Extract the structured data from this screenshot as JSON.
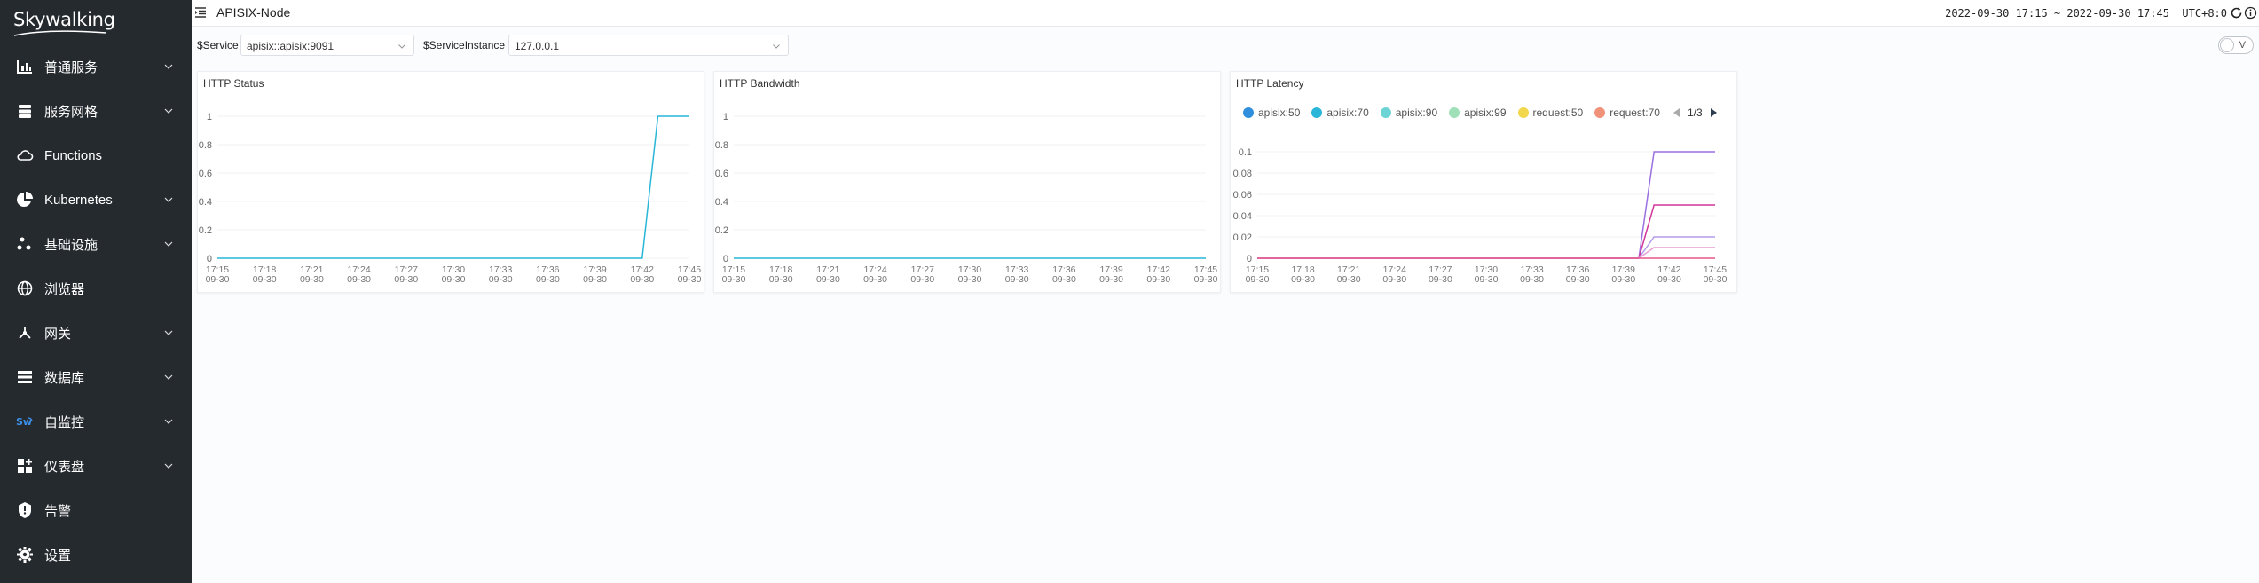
{
  "app": {
    "logo_text": "Skywalking"
  },
  "sidebar": {
    "items": [
      {
        "label": "普通服务",
        "icon": "chart-bar-icon",
        "has_arrow": true
      },
      {
        "label": "服务网格",
        "icon": "database-stack-icon",
        "has_arrow": true
      },
      {
        "label": "Functions",
        "icon": "cloud-icon",
        "has_arrow": false
      },
      {
        "label": "Kubernetes",
        "icon": "pie-chart-icon",
        "has_arrow": true
      },
      {
        "label": "基础设施",
        "icon": "nodes-icon",
        "has_arrow": true
      },
      {
        "label": "浏览器",
        "icon": "globe-icon",
        "has_arrow": false
      },
      {
        "label": "网关",
        "icon": "gateway-icon",
        "has_arrow": true
      },
      {
        "label": "数据库",
        "icon": "list-icon",
        "has_arrow": true
      },
      {
        "label": "自监控",
        "icon": "sw-icon",
        "has_arrow": true
      },
      {
        "label": "仪表盘",
        "icon": "dashboard-grid-icon",
        "has_arrow": true
      },
      {
        "label": "告警",
        "icon": "alert-shield-icon",
        "has_arrow": false
      },
      {
        "label": "设置",
        "icon": "gear-icon",
        "has_arrow": false
      }
    ]
  },
  "header": {
    "title": "APISIX-Node",
    "time_range": "2022-09-30 17:15 ~ 2022-09-30 17:45",
    "timezone": "UTC+8:0"
  },
  "filters": {
    "service_label": "$Service",
    "service_value": "apisix::apisix:9091",
    "instance_label": "$ServiceInstance",
    "instance_value": "127.0.0.1",
    "toggle_label": "V"
  },
  "chart_data": [
    {
      "type": "line",
      "title": "HTTP Status",
      "x": [
        "17:15\n09-30",
        "17:18\n09-30",
        "17:21\n09-30",
        "17:24\n09-30",
        "17:27\n09-30",
        "17:30\n09-30",
        "17:33\n09-30",
        "17:36\n09-30",
        "17:39\n09-30",
        "17:42\n09-30",
        "17:45\n09-30"
      ],
      "yticks": [
        "0",
        "0.2",
        "0.4",
        "0.6",
        "0.8",
        "1"
      ],
      "ylim": [
        0,
        1
      ],
      "series": [
        {
          "color": "#29b6d8",
          "values": [
            0,
            0,
            0,
            0,
            0,
            0,
            0,
            0,
            0,
            0,
            0,
            0,
            0,
            0,
            0,
            0,
            0,
            0,
            0,
            0,
            0,
            0,
            0,
            0,
            0,
            0,
            0,
            0,
            1,
            1,
            1
          ]
        }
      ]
    },
    {
      "type": "line",
      "title": "HTTP Bandwidth",
      "x": [
        "17:15\n09-30",
        "17:18\n09-30",
        "17:21\n09-30",
        "17:24\n09-30",
        "17:27\n09-30",
        "17:30\n09-30",
        "17:33\n09-30",
        "17:36\n09-30",
        "17:39\n09-30",
        "17:42\n09-30",
        "17:45\n09-30"
      ],
      "yticks": [
        "0",
        "0.2",
        "0.4",
        "0.6",
        "0.8",
        "1"
      ],
      "ylim": [
        0,
        1
      ],
      "series": [
        {
          "color": "#29b6d8",
          "values": [
            0,
            0,
            0,
            0,
            0,
            0,
            0,
            0,
            0,
            0,
            0,
            0,
            0,
            0,
            0,
            0,
            0,
            0,
            0,
            0,
            0,
            0,
            0,
            0,
            0,
            0,
            0,
            0,
            0,
            0,
            0
          ]
        }
      ]
    },
    {
      "type": "line",
      "title": "HTTP Latency",
      "x": [
        "17:15\n09-30",
        "17:18\n09-30",
        "17:21\n09-30",
        "17:24\n09-30",
        "17:27\n09-30",
        "17:30\n09-30",
        "17:33\n09-30",
        "17:36\n09-30",
        "17:39\n09-30",
        "17:42\n09-30",
        "17:45\n09-30"
      ],
      "yticks": [
        "0",
        "0.02",
        "0.04",
        "0.06",
        "0.08",
        "0.1"
      ],
      "ylim": [
        0,
        0.1
      ],
      "legend": {
        "items": [
          {
            "name": "apisix:50",
            "color": "#2f8fdc"
          },
          {
            "name": "apisix:70",
            "color": "#29b6d8"
          },
          {
            "name": "apisix:90",
            "color": "#6cd4d4"
          },
          {
            "name": "apisix:99",
            "color": "#9fe0b8"
          },
          {
            "name": "request:50",
            "color": "#f2d64b"
          },
          {
            "name": "request:70",
            "color": "#f0917a"
          }
        ],
        "page": "1/3"
      },
      "series": [
        {
          "color": "#9a6fe0",
          "values": [
            0,
            0,
            0,
            0,
            0,
            0,
            0,
            0,
            0,
            0,
            0,
            0,
            0,
            0,
            0,
            0,
            0,
            0,
            0,
            0,
            0,
            0,
            0,
            0,
            0,
            0,
            0.1,
            0.1,
            0.1,
            0.1,
            0.1
          ]
        },
        {
          "color": "#d1369a",
          "values": [
            0,
            0,
            0,
            0,
            0,
            0,
            0,
            0,
            0,
            0,
            0,
            0,
            0,
            0,
            0,
            0,
            0,
            0,
            0,
            0,
            0,
            0,
            0,
            0,
            0,
            0,
            0.05,
            0.05,
            0.05,
            0.05,
            0.05
          ]
        },
        {
          "color": "#b39be8",
          "values": [
            0,
            0,
            0,
            0,
            0,
            0,
            0,
            0,
            0,
            0,
            0,
            0,
            0,
            0,
            0,
            0,
            0,
            0,
            0,
            0,
            0,
            0,
            0,
            0,
            0,
            0,
            0.02,
            0.02,
            0.02,
            0.02,
            0.02
          ]
        },
        {
          "color": "#e6a0d2",
          "values": [
            0,
            0,
            0,
            0,
            0,
            0,
            0,
            0,
            0,
            0,
            0,
            0,
            0,
            0,
            0,
            0,
            0,
            0,
            0,
            0,
            0,
            0,
            0,
            0,
            0,
            0,
            0.01,
            0.01,
            0.01,
            0.01,
            0.01
          ]
        },
        {
          "color": "#e8578c",
          "values": [
            0,
            0,
            0,
            0,
            0,
            0,
            0,
            0,
            0,
            0,
            0,
            0,
            0,
            0,
            0,
            0,
            0,
            0,
            0,
            0,
            0,
            0,
            0,
            0,
            0,
            0,
            0,
            0,
            0,
            0,
            0
          ]
        }
      ]
    }
  ]
}
